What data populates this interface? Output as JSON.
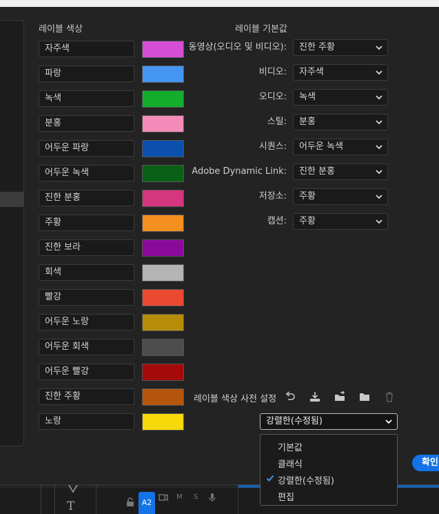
{
  "headings": {
    "label_colors": "레이블 색상",
    "label_defaults": "레이블 기본값"
  },
  "label_colors": [
    {
      "name": "자주색",
      "color": "#d64ed6"
    },
    {
      "name": "파랑",
      "color": "#4596f3"
    },
    {
      "name": "녹색",
      "color": "#14ad2b"
    },
    {
      "name": "분홍",
      "color": "#f48cba"
    },
    {
      "name": "어두운 파랑",
      "color": "#0b50ac"
    },
    {
      "name": "어두운 녹색",
      "color": "#0a6116"
    },
    {
      "name": "진한 분홍",
      "color": "#d6357f"
    },
    {
      "name": "주황",
      "color": "#f3901f"
    },
    {
      "name": "진한 보라",
      "color": "#8a0a9b"
    },
    {
      "name": "회색",
      "color": "#b4b4b4"
    },
    {
      "name": "빨강",
      "color": "#eb4a31"
    },
    {
      "name": "어두운 노랑",
      "color": "#b78d08"
    },
    {
      "name": "어두운 회색",
      "color": "#4d4d4d"
    },
    {
      "name": "어두운 빨강",
      "color": "#a50a0a"
    },
    {
      "name": "진한 주황",
      "color": "#b6560c"
    },
    {
      "name": "노랑",
      "color": "#f6d80b"
    }
  ],
  "label_defaults": [
    {
      "label": "동영상(오디오 및 비디오):",
      "value": "진한 주황"
    },
    {
      "label": "비디오:",
      "value": "자주색"
    },
    {
      "label": "오디오:",
      "value": "녹색"
    },
    {
      "label": "스틸:",
      "value": "분홍"
    },
    {
      "label": "시퀀스:",
      "value": "어두운 녹색"
    },
    {
      "label": "Adobe Dynamic Link:",
      "value": "진한 분홍"
    },
    {
      "label": "저장소:",
      "value": "주황"
    },
    {
      "label": "캡션:",
      "value": "주황"
    }
  ],
  "preset": {
    "label": "레이블 색상 사전 설정",
    "selected": "강렬한(수정됨)",
    "icons": [
      "undo-icon",
      "import-icon",
      "export-icon",
      "folder-icon",
      "trash-icon"
    ],
    "options": [
      "기본값",
      "클래식",
      "강렬한(수정됨)",
      "편집"
    ]
  },
  "ok_button": "확인",
  "timeline": {
    "track_label": "A2",
    "mute": "M",
    "solo": "S"
  },
  "accent": "#1473e6"
}
